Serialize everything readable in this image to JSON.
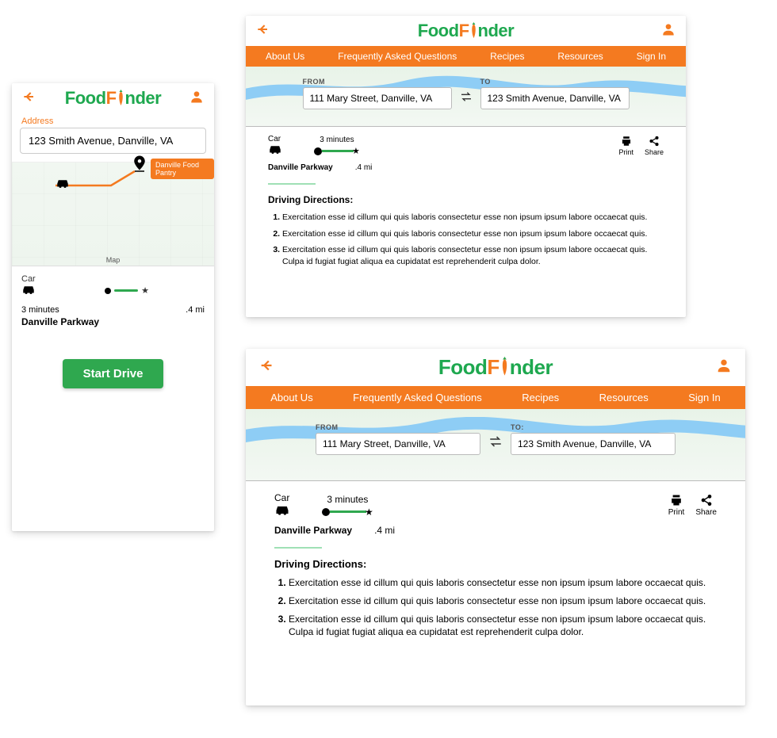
{
  "brand": {
    "prefix": "Food",
    "mid": "F",
    "suffix": "nder"
  },
  "nav": {
    "about": "About Us",
    "faq": "Frequently Asked Questions",
    "recipes": "Recipes",
    "resources": "Resources",
    "signin": "Sign In"
  },
  "mobile": {
    "address_label": "Address",
    "address_value": "123 Smith Avenue, Danville, VA",
    "pantry_tag": "Danville Food Pantry",
    "map_label": "Map",
    "mode_label": "Car",
    "time": "3 minutes",
    "distance": ".4 mi",
    "route_road": "Danville Parkway",
    "start_button": "Start Drive"
  },
  "directions": {
    "from_label": "FROM",
    "to_label": "TO",
    "to_label_colon": "TO:",
    "from_value": "111 Mary Street, Danville, VA",
    "to_value": "123 Smith Avenue, Danville, VA",
    "mode_label": "Car",
    "time": "3 minutes",
    "route_road": "Danville Parkway",
    "distance": ".4 mi",
    "print_label": "Print",
    "share_label": "Share",
    "heading": "Driving Directions:",
    "steps": [
      "Exercitation esse id cillum qui quis laboris consectetur esse non ipsum ipsum labore occaecat quis.",
      "Exercitation esse id cillum qui quis laboris consectetur esse non ipsum ipsum labore occaecat quis.",
      "Exercitation esse id cillum qui quis laboris consectetur esse non ipsum ipsum labore occaecat quis. Culpa id fugiat fugiat aliqua ea cupidatat est reprehenderit culpa dolor."
    ]
  }
}
